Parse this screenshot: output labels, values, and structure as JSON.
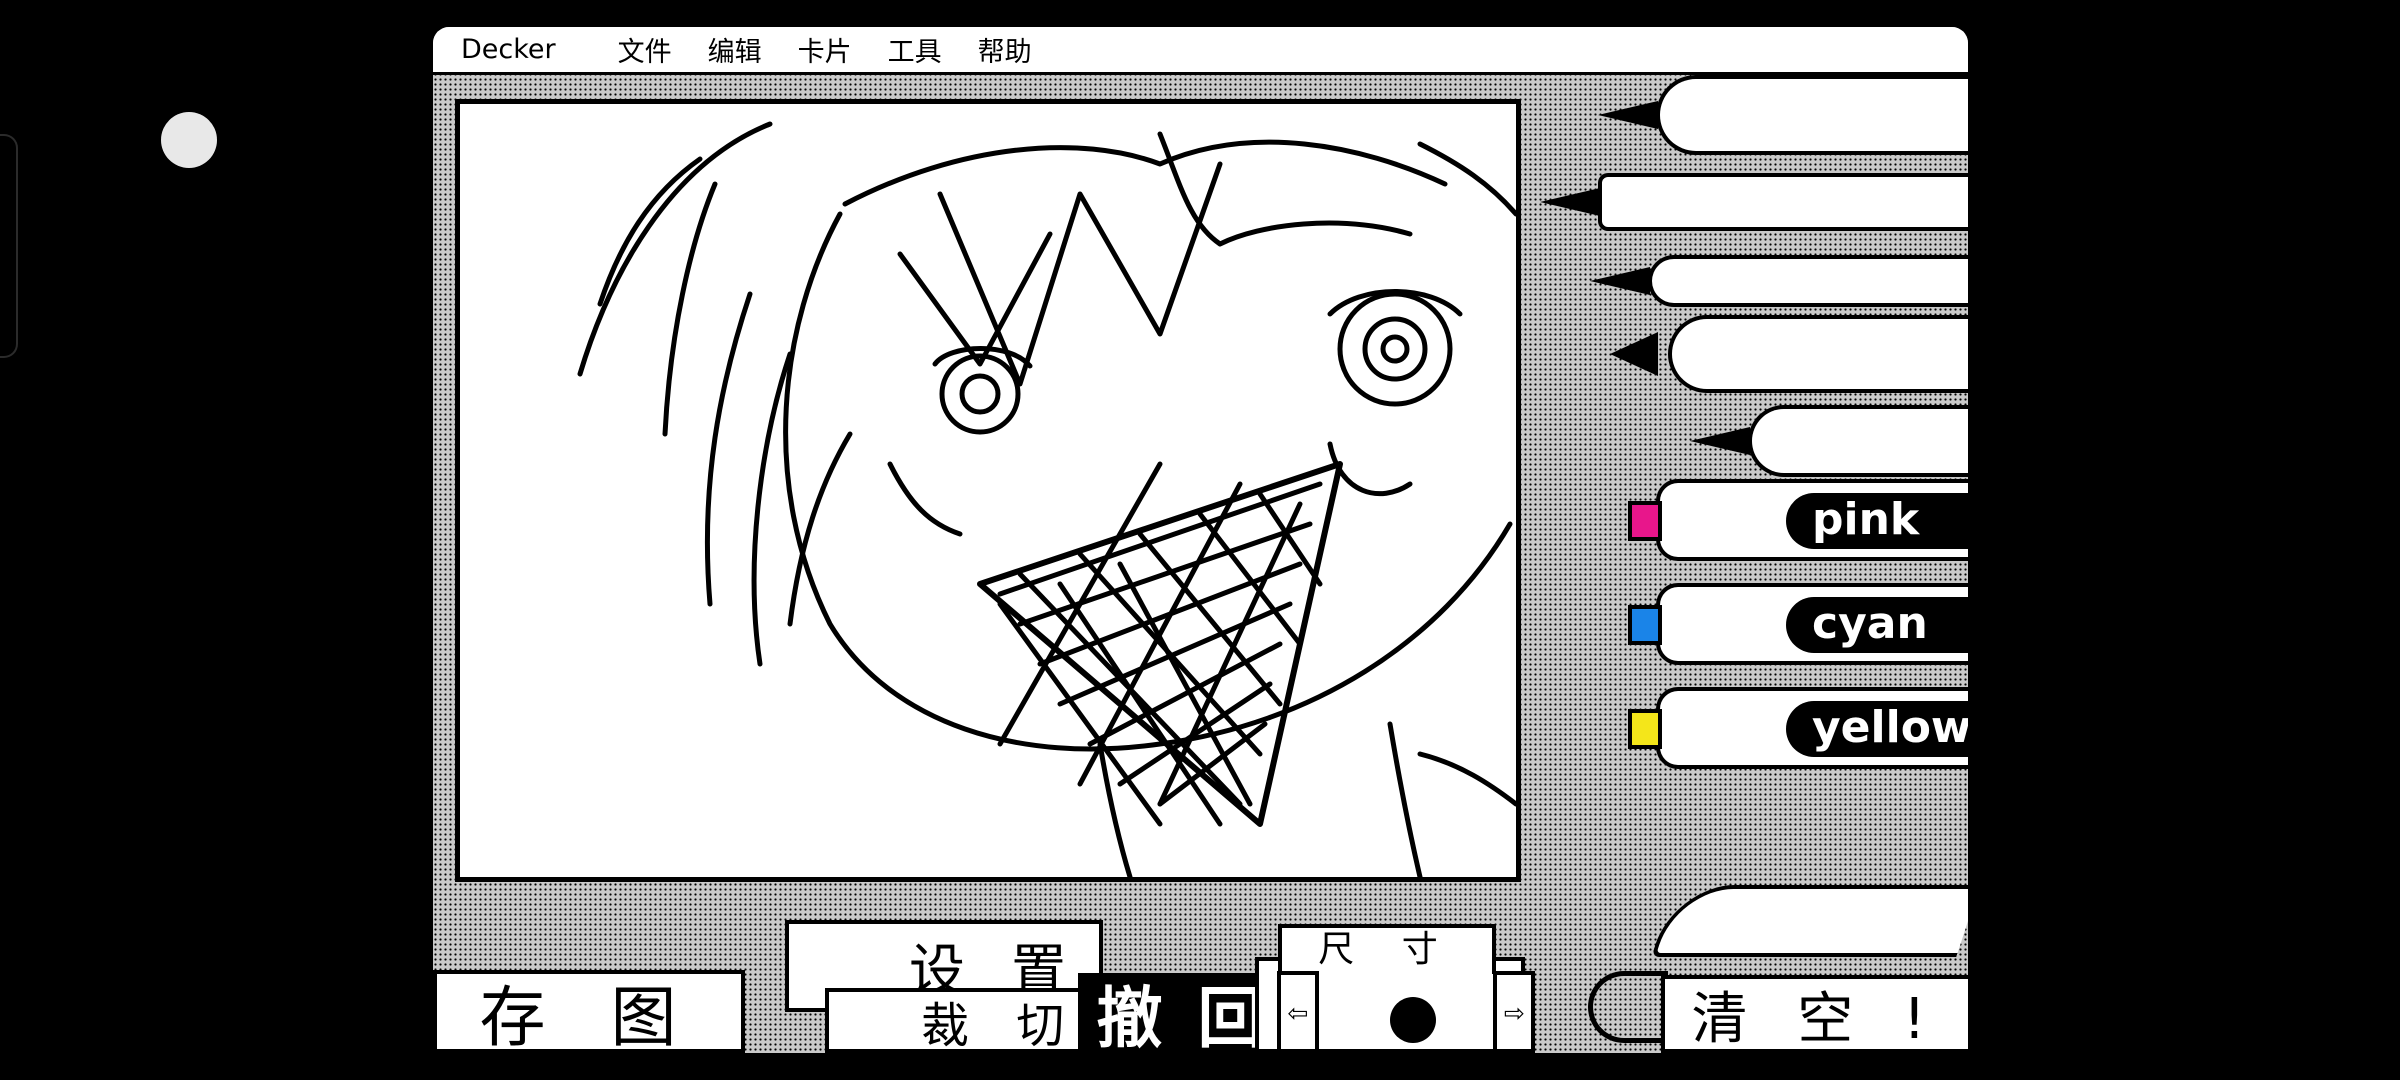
{
  "menubar": {
    "app_title": "Decker",
    "items": [
      "文件",
      "编辑",
      "卡片",
      "工具",
      "帮助"
    ]
  },
  "tools": {
    "pens": [
      "fountain-pen-icon",
      "technical-pen-icon",
      "ink-brush-icon",
      "spray-icon",
      "finger-smudge-icon"
    ],
    "markers": [
      {
        "label": "pink",
        "color": "#e8168b"
      },
      {
        "label": "cyan",
        "color": "#1a84e8"
      },
      {
        "label": "yellow",
        "color": "#f4e61a"
      }
    ],
    "eraser": "eraser-icon"
  },
  "bottom_bar": {
    "save_label": "存 图",
    "settings_label": "设 置",
    "crop_label": "裁 切",
    "undo_label": "撤 回",
    "size_label": "尺 寸",
    "size_left_arrow": "⇦",
    "size_right_arrow": "⇨",
    "clear_label": "清 空 !"
  },
  "colors": {
    "screen_bg": "#000000",
    "panel_bg": "#ffffff",
    "ink": "#000000"
  }
}
